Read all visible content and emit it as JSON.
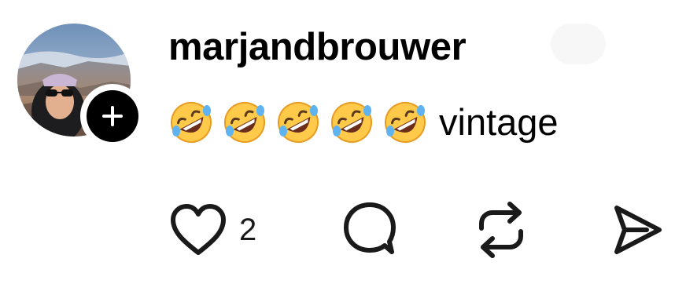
{
  "post": {
    "author": {
      "username": "marjandbrouwer",
      "avatar_icon": "profile-photo"
    },
    "follow_icon": "plus-icon",
    "emojis": [
      "rolling-on-floor-laughing",
      "rolling-on-floor-laughing",
      "rolling-on-floor-laughing",
      "rolling-on-floor-laughing",
      "rolling-on-floor-laughing"
    ],
    "text": "vintage"
  },
  "actions": {
    "like": {
      "icon": "heart-icon",
      "count": "2"
    },
    "reply": {
      "icon": "comment-icon"
    },
    "repost": {
      "icon": "repost-icon"
    },
    "share": {
      "icon": "send-icon"
    }
  },
  "colors": {
    "text": "#000000",
    "icon": "#1a1a1a",
    "badge": "#000000"
  }
}
